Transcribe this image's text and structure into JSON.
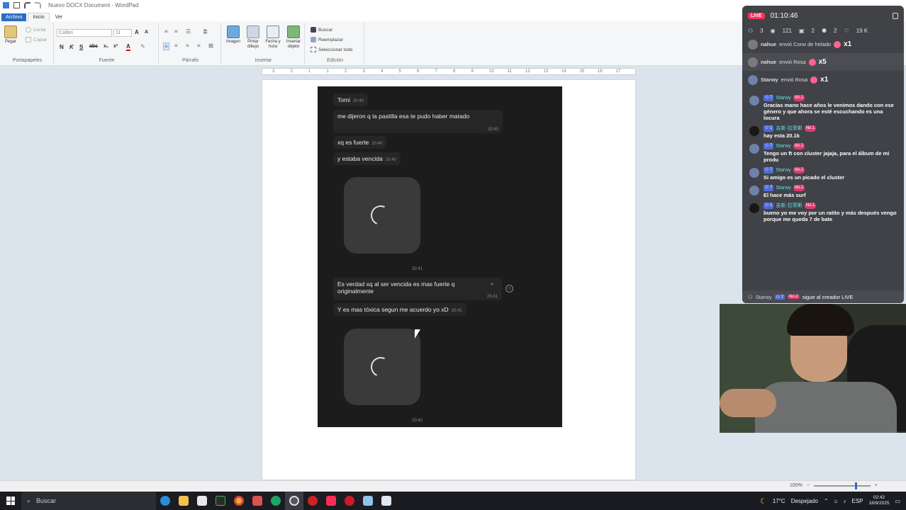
{
  "window": {
    "title": "Nuevo DOCX Document - WordPad"
  },
  "ribbon": {
    "tabs": [
      "Archivo",
      "Inicio",
      "Ver"
    ],
    "portapapeles": {
      "paste": "Pegar",
      "cut": "Cortar",
      "copy": "Copiar",
      "group": "Portapapeles"
    },
    "fuente": {
      "font_name": "Calibri",
      "font_size": "11",
      "group": "Fuente"
    },
    "parrafo": {
      "group": "Párrafo"
    },
    "insertar": {
      "image": "Imagen",
      "paint": "Pintar dibujo",
      "datetime": "Fecha y hora",
      "object": "Insertar objeto",
      "group": "Insertar"
    },
    "edicion": {
      "find": "Buscar",
      "replace": "Reemplazar",
      "select_all": "Seleccionar todo",
      "group": "Edición"
    }
  },
  "ruler": {
    "ticks": [
      "3",
      "2",
      "1",
      "1",
      "2",
      "3",
      "4",
      "5",
      "6",
      "7",
      "8",
      "9",
      "10",
      "11",
      "12",
      "13",
      "14",
      "15",
      "16",
      "17"
    ]
  },
  "chat": {
    "messages": [
      {
        "text": "Tomi",
        "time": "20:40"
      },
      {
        "text": "me dijeron q la pastilla esa te pudo haber matado",
        "time": "20:40"
      },
      {
        "text": "xq es fuerte",
        "time": "20:40"
      },
      {
        "text": "y estaba vencida",
        "time": "20:40"
      },
      {
        "text": "Es verdad xq al ser vencida es mas fuerte q originalmente",
        "time": "20:41"
      },
      {
        "text": "Y es mas tóxica segun me acuerdo yo xD",
        "time": "20:41"
      }
    ],
    "media_times": [
      "20:41",
      "20:42"
    ]
  },
  "statusbar": {
    "zoom": "100%"
  },
  "taskbar": {
    "search_placeholder": "Buscar",
    "weather_temp": "17°C",
    "weather_desc": "Despejado",
    "lang": "ESP",
    "time": "02:42",
    "date": "18/9/2025"
  },
  "stream": {
    "live_label": "LIVE",
    "timer": "01:10:46",
    "stats": [
      "3",
      "121",
      "2",
      "2",
      "19 K"
    ],
    "gifts": [
      {
        "user": "nahue",
        "text": "envió Cono de helado",
        "mult": "x1"
      },
      {
        "user": "nahue",
        "text": "envió Rosa",
        "mult": "x5"
      },
      {
        "user": "Starwy",
        "text": "envió Rosa",
        "mult": "x1"
      }
    ],
    "comments": [
      {
        "level": "7",
        "user": "Starwy",
        "rank": "No.2",
        "text": "Gracias mano hace años le venimos dando con ese género y que ahora se esté escuchando es una locura",
        "avatar": "#6b7fa8"
      },
      {
        "level": "1",
        "user": "吉新·拉菲斯",
        "rank": "No.1",
        "text": "hay esta 20.1k",
        "avatar": "#111111"
      },
      {
        "level": "7",
        "user": "Starwy",
        "rank": "No.2",
        "text": "Tengo un ft con cluster jajaja, para el álbum de mi produ",
        "avatar": "#6b7fa8"
      },
      {
        "level": "7",
        "user": "Starwy",
        "rank": "No.2",
        "text": "Si amigo es un picado el cluster",
        "avatar": "#6b7fa8"
      },
      {
        "level": "7",
        "user": "Starwy",
        "rank": "No.2",
        "text": "El hace más surf",
        "avatar": "#6b7fa8"
      },
      {
        "level": "1",
        "user": "吉新·拉菲斯",
        "rank": "No.1",
        "text": "bueno yo me voy por un ratito y más después vengo porque me queda 7 de bate",
        "avatar": "#111111"
      }
    ],
    "footer": {
      "user": "Starwy",
      "level": "7",
      "rank": "No.2",
      "text": "sigue al creador LIVE"
    }
  }
}
